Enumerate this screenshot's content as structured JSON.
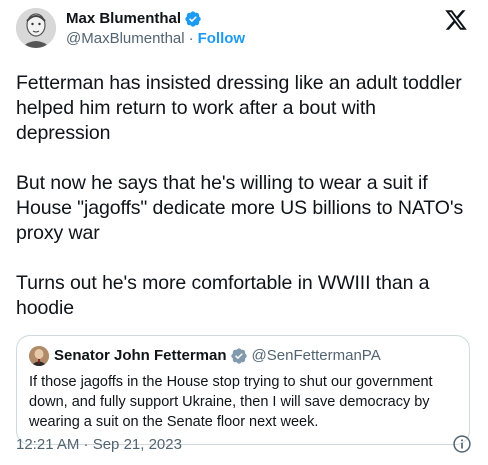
{
  "author": {
    "name": "Max Blumenthal",
    "handle": "@MaxBlumenthal",
    "separator": "·",
    "follow_label": "Follow",
    "verified_icon": "verified-badge-icon",
    "verified_color": "#1d9bf0"
  },
  "platform_logo": "x-logo-icon",
  "tweet": {
    "paragraphs": [
      "Fetterman has insisted dressing like an adult toddler helped him return to work after a bout with depression",
      "But now he says that he's willing to wear a suit if House \"jagoffs\" dedicate more US billions to NATO's proxy war",
      "Turns out he's more comfortable in WWIII than a hoodie"
    ]
  },
  "quoted": {
    "name": "Senator John Fetterman",
    "handle": "@SenFettermanPA",
    "verified_icon": "verified-badge-icon",
    "text": "If those jagoffs in the House stop trying to shut our government down, and fully support Ukraine, then I will save democracy by wearing a suit on the Senate floor next week."
  },
  "footer": {
    "timestamp": "12:21 AM · Sep 21, 2023",
    "info_icon": "info-icon"
  },
  "colors": {
    "text": "#0f1419",
    "secondary": "#536471",
    "accent": "#1d9bf0",
    "border": "#cfd9de"
  }
}
